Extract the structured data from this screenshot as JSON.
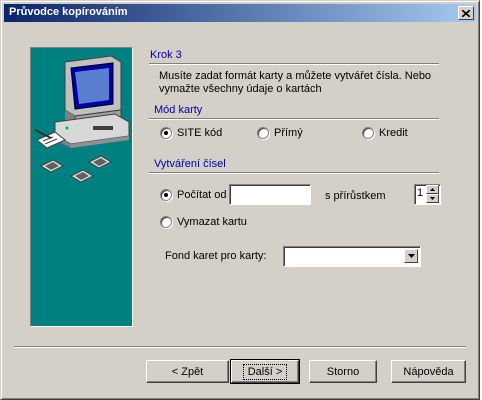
{
  "window": {
    "title": "Průvodce kopírováním",
    "close_glyph": "✕"
  },
  "step": {
    "title": "Krok 3",
    "description": "Musíte zadat formát karty a můžete vytvářet čísla. Nebo vymažte všechny údaje o kartách"
  },
  "card_mode": {
    "label": "Mód karty",
    "options": [
      {
        "label": "SITE kód",
        "checked": true
      },
      {
        "label": "Přímý",
        "checked": false
      },
      {
        "label": "Kredit",
        "checked": false
      }
    ]
  },
  "numbering": {
    "label": "Vytváření čísel",
    "count_from_label": "Počítat od",
    "count_from_value": "",
    "increment_label": "s přírůstkem",
    "increment_value": "1",
    "erase_card_label": "Vymazat kartu",
    "fund_label": "Fond karet pro karty:",
    "fund_value": ""
  },
  "buttons": {
    "back": "< Zpět",
    "next": "Další >",
    "cancel": "Storno",
    "help": "Nápověda"
  },
  "colors": {
    "titlebar_start": "#0a246a",
    "titlebar_end": "#a6caf0",
    "side_panel": "#008080",
    "heading_blue": "#0000a0"
  },
  "icons": [
    "close-icon",
    "computer-illustration-icon",
    "spin-up-icon",
    "spin-down-icon",
    "dropdown-arrow-icon"
  ]
}
